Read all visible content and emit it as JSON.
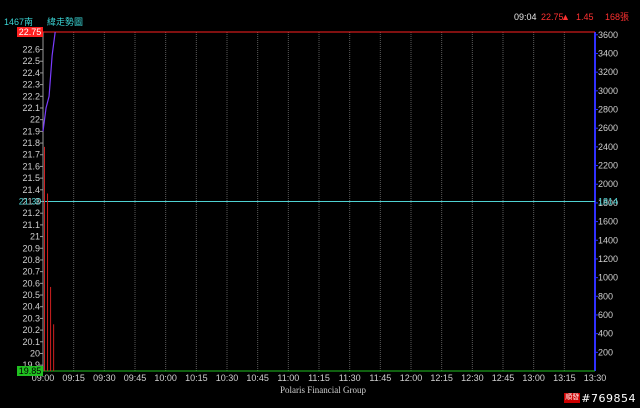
{
  "header": {
    "stock_name": "1467南",
    "chart_title": "緯走勢圖",
    "time": "09:04",
    "price": "22.75",
    "arrow": "▲",
    "change": "1.45",
    "volume": "168張"
  },
  "footer": {
    "company": "Polaris Financial Group"
  },
  "watermark": {
    "badge": "順發",
    "id": "#769854"
  },
  "colors": {
    "background": "#000000",
    "grid": "#5a5a5a",
    "left_axis": "#9a9a9a",
    "right_axis": "#3030ff",
    "upper_limit": "#ff2020",
    "lower_limit": "#20c020",
    "reference": "#4fd2d2",
    "price_line": "#7a3cff",
    "volume_bars": "#d02020",
    "tick_text": "#d0d0d0"
  },
  "chart_data": {
    "type": "line",
    "title": "",
    "xlabel": "",
    "ylabel": "",
    "x_ticks": [
      "09:00",
      "09:15",
      "09:30",
      "09:45",
      "10:00",
      "10:15",
      "10:30",
      "10:45",
      "11:00",
      "11:15",
      "11:30",
      "11:45",
      "12:00",
      "12:15",
      "12:30",
      "12:45",
      "13:00",
      "13:15",
      "13:30"
    ],
    "xlim": [
      "09:00",
      "13:30"
    ],
    "y_ticks": [
      "22.6",
      "22.5",
      "22.4",
      "22.3",
      "22.2",
      "22.1",
      "22",
      "21.9",
      "21.8",
      "21.7",
      "21.6",
      "21.5",
      "21.4",
      "21.3",
      "21.2",
      "21.1",
      "21",
      "20.9",
      "20.8",
      "20.7",
      "20.6",
      "20.5",
      "20.4",
      "20.3",
      "20.2",
      "20.1",
      "20",
      "19.9"
    ],
    "ylim": [
      19.85,
      22.75
    ],
    "upper_limit": {
      "value": 22.75,
      "label": "22.75"
    },
    "lower_limit": {
      "value": 19.85,
      "label": "19.85"
    },
    "reference": {
      "value": 21.3,
      "label": "21.30",
      "volume_label": "1814"
    },
    "volume_ticks": [
      "3600",
      "3400",
      "3200",
      "3000",
      "2800",
      "2600",
      "2400",
      "2200",
      "2000",
      "1800",
      "1600",
      "1400",
      "1200",
      "1000",
      "800",
      "600",
      "400",
      "200"
    ],
    "volume_lim": [
      0,
      3630
    ],
    "price_series": {
      "x": [
        "09:00",
        "09:01",
        "09:02",
        "09:03",
        "09:04"
      ],
      "values": [
        21.9,
        22.1,
        22.2,
        22.55,
        22.75
      ]
    },
    "volume_series": {
      "x": [
        "09:00",
        "09:01",
        "09:02",
        "09:03"
      ],
      "values": [
        2400,
        1900,
        900,
        500
      ]
    }
  }
}
